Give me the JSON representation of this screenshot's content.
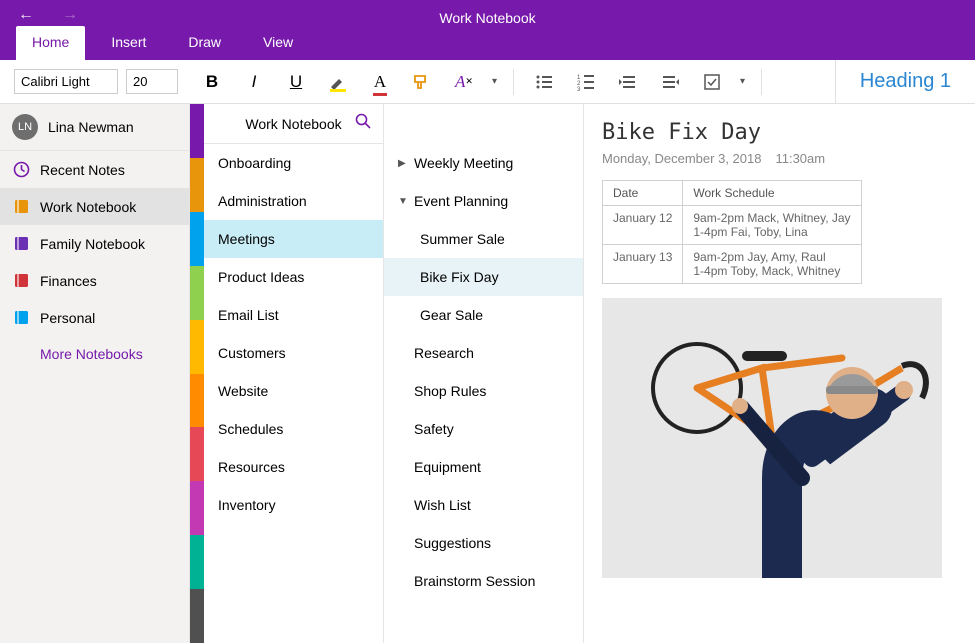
{
  "app_title": "Work Notebook",
  "ribbon_tabs": [
    "Home",
    "Insert",
    "Draw",
    "View"
  ],
  "toolbar": {
    "font_name": "Calibri Light",
    "font_size": "20",
    "heading_label": "Heading 1"
  },
  "user": {
    "initials": "LN",
    "name": "Lina Newman"
  },
  "sidebar": {
    "items": [
      {
        "label": "Recent Notes",
        "icon": "clock",
        "color": "#7719AA"
      },
      {
        "label": "Work Notebook",
        "icon": "book",
        "color": "#e8950c",
        "selected": true
      },
      {
        "label": "Family Notebook",
        "icon": "book",
        "color": "#6b2fb3"
      },
      {
        "label": "Finances",
        "icon": "book",
        "color": "#d13438"
      },
      {
        "label": "Personal",
        "icon": "book",
        "color": "#00a2ed"
      }
    ],
    "more_label": "More Notebooks"
  },
  "panel_title": "Work Notebook",
  "tab_colors": [
    "#7719AA",
    "#e8950c",
    "#00a2ed",
    "#8fd14f",
    "#ffb900",
    "#ff8c00",
    "#e74856",
    "#c239b3",
    "#00b294",
    "#505050"
  ],
  "sections": [
    "Onboarding",
    "Administration",
    "Meetings",
    "Product Ideas",
    "Email List",
    "Customers",
    "Website",
    "Schedules",
    "Resources",
    "Inventory"
  ],
  "selected_section_index": 2,
  "pages": [
    {
      "label": "Weekly Meeting",
      "chev": ">",
      "level": 0
    },
    {
      "label": "Event Planning",
      "chev": "v",
      "level": 0
    },
    {
      "label": "Summer Sale",
      "level": 1
    },
    {
      "label": "Bike Fix Day",
      "level": 1,
      "selected": true
    },
    {
      "label": "Gear Sale",
      "level": 1
    },
    {
      "label": "Research",
      "level": 0
    },
    {
      "label": "Shop Rules",
      "level": 0
    },
    {
      "label": "Safety",
      "level": 0
    },
    {
      "label": "Equipment",
      "level": 0
    },
    {
      "label": "Wish List",
      "level": 0
    },
    {
      "label": "Suggestions",
      "level": 0
    },
    {
      "label": "Brainstorm Session",
      "level": 0
    }
  ],
  "content": {
    "title": "Bike Fix Day",
    "date": "Monday, December 3, 2018",
    "time": "11:30am",
    "table": {
      "headers": [
        "Date",
        "Work Schedule"
      ],
      "rows": [
        [
          "January 12",
          "9am-2pm Mack, Whitney, Jay\n1-4pm Fai, Toby, Lina"
        ],
        [
          "January 13",
          "9am-2pm Jay, Amy, Raul\n1-4pm Toby, Mack, Whitney"
        ]
      ]
    }
  }
}
